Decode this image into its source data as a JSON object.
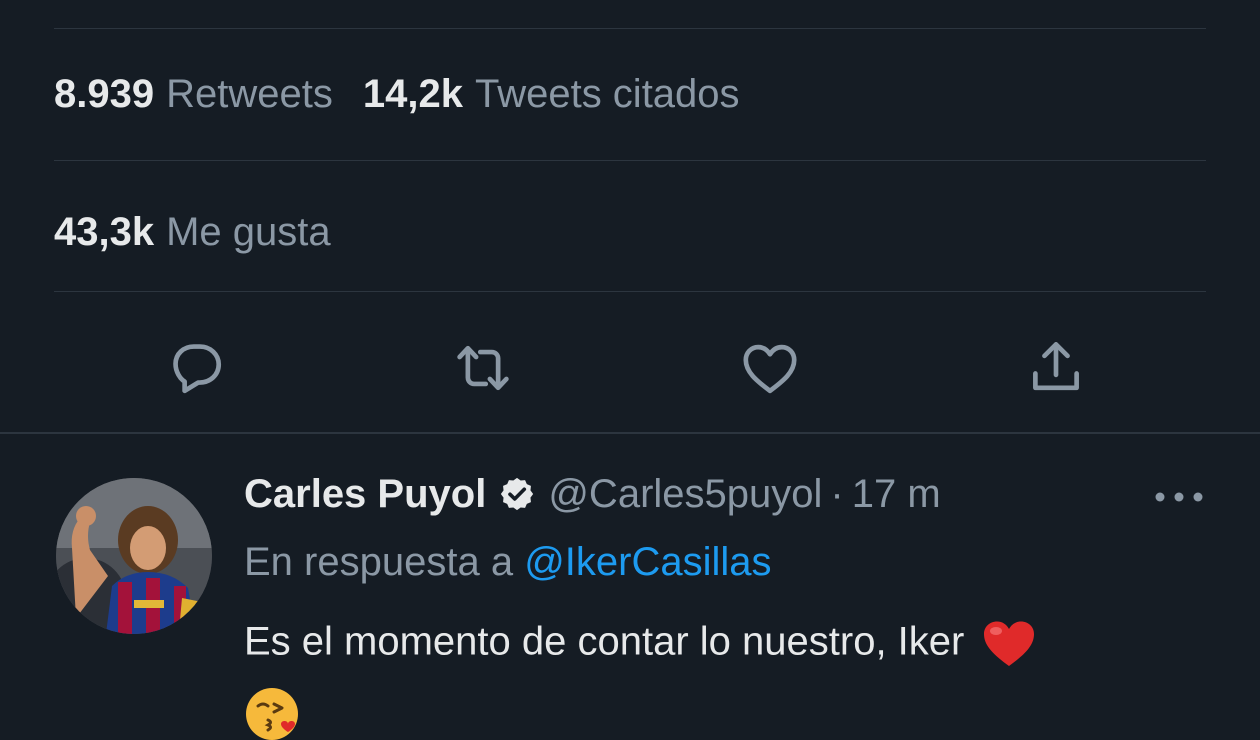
{
  "stats": {
    "retweets_count": "8.939",
    "retweets_label": "Retweets",
    "quotes_count": "14,2k",
    "quotes_label": "Tweets citados",
    "likes_count": "43,3k",
    "likes_label": "Me gusta"
  },
  "actions": [
    {
      "icon": "reply-icon"
    },
    {
      "icon": "retweet-icon"
    },
    {
      "icon": "like-icon"
    },
    {
      "icon": "share-icon"
    }
  ],
  "reply": {
    "author_name": "Carles Puyol",
    "handle": "@Carles5puyol",
    "separator": "·",
    "time": "17 m",
    "in_reply_prefix": "En respuesta a",
    "in_reply_mention": "@IkerCasillas",
    "text": "Es el momento de contar lo nuestro, Iker",
    "emojis": [
      "red-heart-emoji",
      "face-blowing-kiss-emoji"
    ]
  },
  "colors": {
    "background": "#151c24",
    "primary_text": "#e7e9ea",
    "secondary_text": "#8b98a5",
    "accent_link": "#1d9bf0",
    "divider": "#2c353f"
  }
}
